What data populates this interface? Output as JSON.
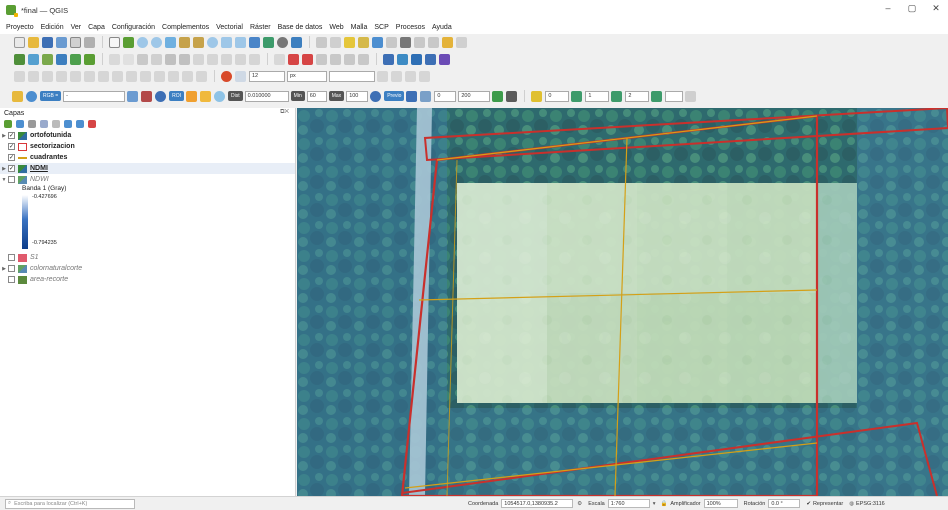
{
  "window": {
    "title": "*final — QGIS",
    "minimize": "–",
    "maximize": "▢",
    "close": "✕"
  },
  "menu": [
    "Proyecto",
    "Edición",
    "Ver",
    "Capa",
    "Configuración",
    "Complementos",
    "Vectorial",
    "Ráster",
    "Base de datos",
    "Web",
    "Malla",
    "SCP",
    "Procesos",
    "Ayuda"
  ],
  "scp_toolbar": {
    "rgb_label": "RGB =",
    "rgb_value": "-",
    "roi_label": "ROI",
    "dist_label": "Dist",
    "dist_value": "0.010000",
    "min_label": "Min",
    "min_value": "60",
    "max_label": "Max",
    "max_value": "100",
    "preview_label": "Previo",
    "b_value": "0",
    "s_value": "200",
    "field1": "0",
    "field2": "1",
    "field3": "2",
    "size_value": "12",
    "unit_value": "px"
  },
  "layers_panel": {
    "title": "Capas",
    "layers": [
      {
        "name": "ortofotunida",
        "checked": true,
        "bold": true,
        "italic": false,
        "expanded": false
      },
      {
        "name": "sectorizacion",
        "checked": true,
        "bold": true,
        "italic": false,
        "expanded": false
      },
      {
        "name": "cuadrantes",
        "checked": true,
        "bold": true,
        "italic": false,
        "expanded": false
      },
      {
        "name": "NDMI",
        "checked": true,
        "bold": true,
        "italic": false,
        "expanded": false
      },
      {
        "name": "NDWI",
        "checked": false,
        "bold": false,
        "italic": true,
        "expanded": true
      },
      {
        "name": "S1",
        "checked": false,
        "bold": false,
        "italic": true,
        "expanded": false
      },
      {
        "name": "colornaturalcorte",
        "checked": false,
        "bold": false,
        "italic": true,
        "expanded": false
      },
      {
        "name": "area-recorte",
        "checked": false,
        "bold": false,
        "italic": true,
        "expanded": false
      }
    ],
    "legend": {
      "band": "Banda 1 (Gray)",
      "max": "-0.427696",
      "min": "-0.794235"
    },
    "colors": {
      "ortofoto": "#3a8a3a",
      "sectorizacion": "#d9383a",
      "cuadrantes": "#d4a017",
      "s1": "#e05a6d",
      "area": "#5c8a3d"
    }
  },
  "statusbar": {
    "locator_placeholder": "Escriba para localizar (Ctrl+K)",
    "coord_label": "Coordenada",
    "coord_value": "1054517.0,1380935.2",
    "scale_label": "Escala",
    "scale_value": "1:760",
    "magnifier_label": "Amplificador",
    "magnifier_value": "100%",
    "rotation_label": "Rotación",
    "rotation_value": "0.0 °",
    "render_label": "Representar",
    "crs_label": "EPSG:3116"
  }
}
